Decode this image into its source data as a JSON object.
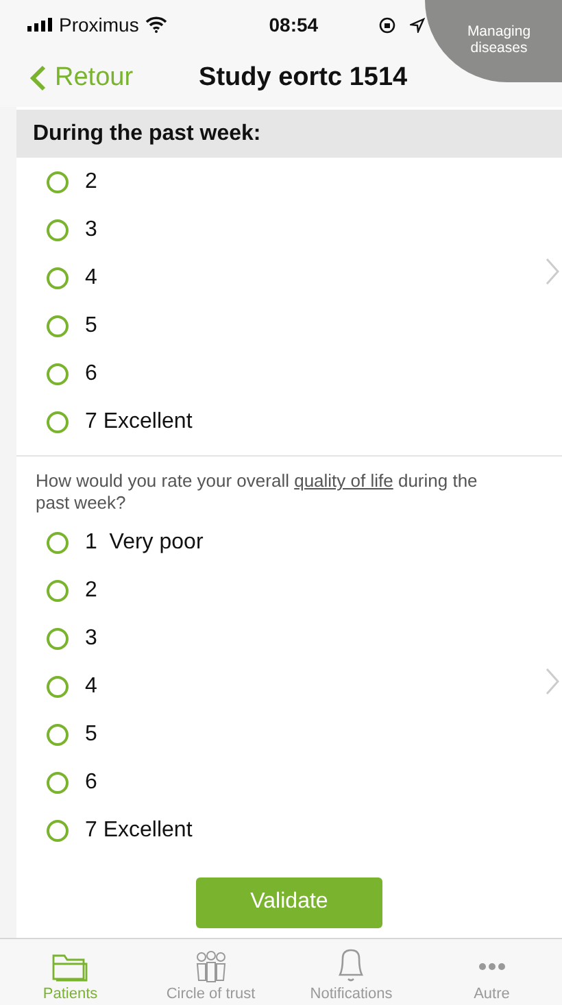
{
  "status_bar": {
    "carrier": "Proximus",
    "time": "08:54"
  },
  "overlay": {
    "label": "Managing diseases"
  },
  "nav": {
    "back": "Retour",
    "title": "Study eortc 1514"
  },
  "section": {
    "title": "During the past week:"
  },
  "question_1": {
    "options": [
      {
        "label": "2",
        "selected": false
      },
      {
        "label": "3",
        "selected": false
      },
      {
        "label": "4",
        "selected": false
      },
      {
        "label": "5",
        "selected": false
      },
      {
        "label": "6",
        "selected": false
      },
      {
        "label": "7 Excellent",
        "selected": false
      }
    ]
  },
  "question_2": {
    "text_before": "How would you rate your overall ",
    "link": "quality of life",
    "text_after": " during the past week?",
    "options": [
      {
        "label": "1  Very poor",
        "selected": false
      },
      {
        "label": "2",
        "selected": false
      },
      {
        "label": "3",
        "selected": false
      },
      {
        "label": "4",
        "selected": false
      },
      {
        "label": "5",
        "selected": false
      },
      {
        "label": "6",
        "selected": false
      },
      {
        "label": "7 Excellent",
        "selected": false
      }
    ]
  },
  "validate_button": "Validate",
  "tabs": [
    {
      "kind": "folder",
      "label": "Patients",
      "selected": true
    },
    {
      "kind": "people",
      "label": "Circle of trust",
      "selected": false
    },
    {
      "kind": "bell",
      "label": "Notifications",
      "selected": false
    },
    {
      "kind": "more",
      "label": "Autre",
      "selected": false
    }
  ]
}
